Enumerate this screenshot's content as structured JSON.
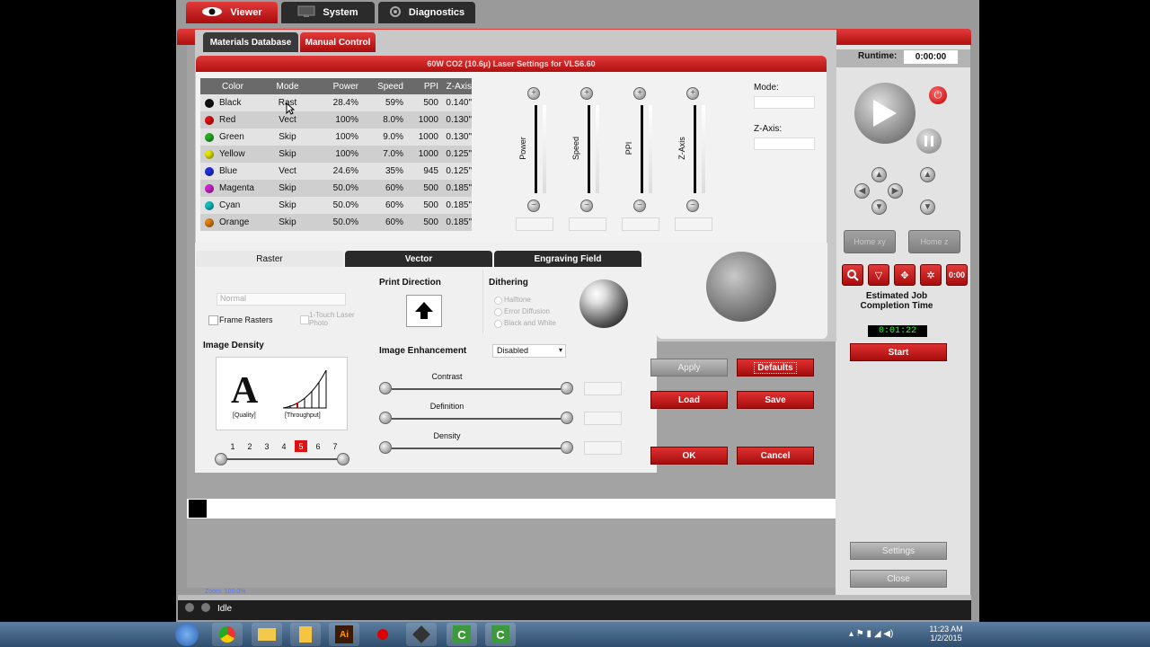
{
  "nav": {
    "tabs": [
      {
        "label": "Viewer",
        "active": true
      },
      {
        "label": "System",
        "active": false
      },
      {
        "label": "Diagnostics",
        "active": false
      }
    ]
  },
  "subtabs": {
    "materials": "Materials Database",
    "manual": "Manual Control"
  },
  "dialog_title": "60W CO2 (10.6µ) Laser Settings for VLS6.60",
  "runtime": {
    "label": "Runtime:",
    "value": "0:00:00"
  },
  "table": {
    "headers": [
      "Color",
      "Mode",
      "Power",
      "Speed",
      "PPI",
      "Z-Axis"
    ],
    "rows": [
      {
        "color": "Black",
        "hex": "#111111",
        "mode": "Rast",
        "power": "28.4%",
        "speed": "59%",
        "ppi": "500",
        "z": "0.140\""
      },
      {
        "color": "Red",
        "hex": "#e01010",
        "mode": "Vect",
        "power": "100%",
        "speed": "8.0%",
        "ppi": "1000",
        "z": "0.130\""
      },
      {
        "color": "Green",
        "hex": "#22b022",
        "mode": "Skip",
        "power": "100%",
        "speed": "9.0%",
        "ppi": "1000",
        "z": "0.130\""
      },
      {
        "color": "Yellow",
        "hex": "#e6e600",
        "mode": "Skip",
        "power": "100%",
        "speed": "7.0%",
        "ppi": "1000",
        "z": "0.125\""
      },
      {
        "color": "Blue",
        "hex": "#2030e0",
        "mode": "Vect",
        "power": "24.6%",
        "speed": "35%",
        "ppi": "945",
        "z": "0.125\""
      },
      {
        "color": "Magenta",
        "hex": "#d020d0",
        "mode": "Skip",
        "power": "50.0%",
        "speed": "60%",
        "ppi": "500",
        "z": "0.185\""
      },
      {
        "color": "Cyan",
        "hex": "#10c0c0",
        "mode": "Skip",
        "power": "50.0%",
        "speed": "60%",
        "ppi": "500",
        "z": "0.185\""
      },
      {
        "color": "Orange",
        "hex": "#e08010",
        "mode": "Skip",
        "power": "50.0%",
        "speed": "60%",
        "ppi": "500",
        "z": "0.185\""
      }
    ]
  },
  "sliders": {
    "labels": [
      "Power",
      "Speed",
      "PPI",
      "Z-Axis"
    ]
  },
  "mode_label": "Mode:",
  "zaxis_label": "Z-Axis:",
  "tabs2": {
    "raster": "Raster",
    "vector": "Vector",
    "engraving": "Engraving Field"
  },
  "raster": {
    "mode_value": "Normal",
    "frame_rasters": "Frame Rasters",
    "one_touch": "1-Touch Laser Photo",
    "image_density": "Image Density",
    "quality": "[Quality]",
    "throughput": "[Throughput]",
    "density_numbers": [
      "1",
      "2",
      "3",
      "4",
      "5",
      "6",
      "7"
    ],
    "density_selected": "5",
    "print_direction": "Print Direction",
    "dithering": "Dithering",
    "dither_options": [
      "Halftone",
      "Error Diffusion",
      "Black and White"
    ],
    "image_enhancement": "Image Enhancement",
    "enhancement_value": "Disabled",
    "contrast": "Contrast",
    "definition": "Definition",
    "density": "Density"
  },
  "buttons": {
    "apply": "Apply",
    "defaults": "Defaults",
    "load": "Load",
    "save": "Save",
    "ok": "OK",
    "cancel": "Cancel",
    "home_xy": "Home xy",
    "home_z": "Home z",
    "start": "Start",
    "settings": "Settings",
    "close": "Close"
  },
  "estimate": {
    "label": "Estimated Job Completion Time",
    "value": "0:01:22"
  },
  "zoom": "Zoom:  100.0%",
  "status": "Idle",
  "clock": {
    "time": "11:23 AM",
    "date": "1/2/2015"
  }
}
